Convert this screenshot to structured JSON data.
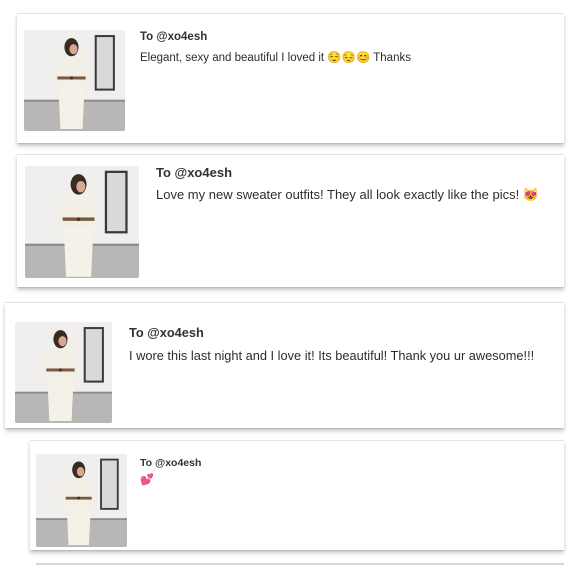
{
  "messages": [
    {
      "recipient": "To @xo4esh",
      "text": "Elegant, sexy and beautiful I loved it 😌😔😊 Thanks"
    },
    {
      "recipient": "To @xo4esh",
      "text": "Love my new sweater outfits! They all look exactly like the pics! 😻"
    },
    {
      "recipient": "To @xo4esh",
      "text": "I wore this last night and I love it! Its beautiful! Thank you ur awesome!!!"
    },
    {
      "recipient": "To @xo4esh",
      "text": "💕"
    }
  ],
  "photo": {
    "subject": "woman-in-cream-sweater-outfit-photo"
  }
}
